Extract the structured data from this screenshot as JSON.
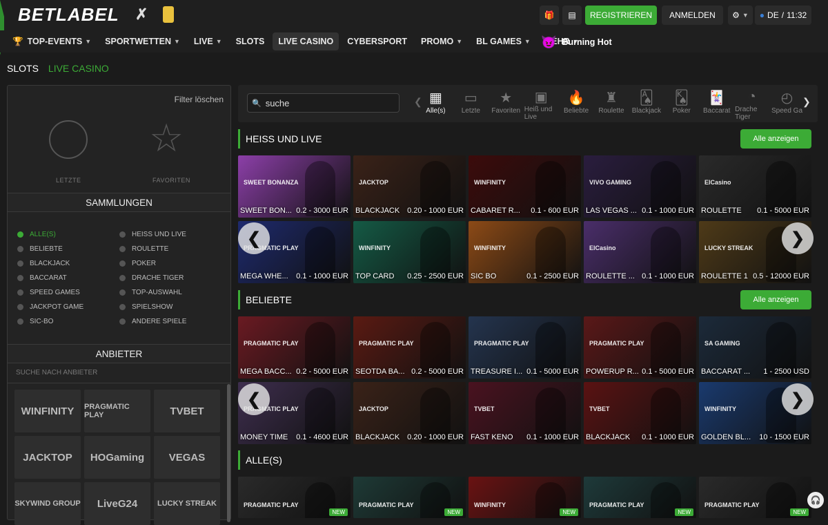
{
  "header": {
    "logo": "BETLABEL",
    "register": "REGISTRIEREN",
    "login": "ANMELDEN",
    "lang": "DE",
    "time": "11:32",
    "gift_count": "1"
  },
  "nav": {
    "items": [
      {
        "label": "TOP-EVENTS",
        "dropdown": true
      },
      {
        "label": "SPORTWETTEN",
        "dropdown": true
      },
      {
        "label": "LIVE",
        "dropdown": true
      },
      {
        "label": "SLOTS",
        "dropdown": false
      },
      {
        "label": "LIVE CASINO",
        "dropdown": false
      },
      {
        "label": "CYBERSPORT",
        "dropdown": false
      },
      {
        "label": "PROMO",
        "dropdown": true
      },
      {
        "label": "BL GAMES",
        "dropdown": true
      },
      {
        "label": "MEHR",
        "dropdown": true
      }
    ],
    "active": "LIVE CASINO",
    "promo": "Burning Hot"
  },
  "subtabs": {
    "slots": "SLOTS",
    "live_casino": "LIVE CASINO"
  },
  "sidebar": {
    "filter_clear": "Filter löschen",
    "recent": "LETZTE",
    "favorites": "FAVORITEN",
    "collections_title": "SAMMLUNGEN",
    "collections": [
      "ALLE(S)",
      "HEISS UND LIVE",
      "BELIEBTE",
      "ROULETTE",
      "BLACKJACK",
      "POKER",
      "BACCARAT",
      "DRACHE TIGER",
      "SPEED GAMES",
      "TOP-AUSWAHL",
      "JACKPOT GAME",
      "SPIELSHOW",
      "SIC-BO",
      "ANDERE SPIELE"
    ],
    "providers_title": "ANBIETER",
    "providers_search": "SUCHE NACH ANBIETER",
    "providers": [
      "WINFINITY",
      "PRAGMATIC PLAY",
      "TVBET",
      "JACKTOP",
      "HOGaming",
      "VEGAS",
      "SKYWIND GROUP",
      "LiveG24",
      "LUCKY STREAK"
    ]
  },
  "toolbar": {
    "search_placeholder": "suche",
    "categories": [
      "Alle(s)",
      "Letzte",
      "Favoriten",
      "Heiß und Live",
      "Beliebte",
      "Roulette",
      "Blackjack",
      "Poker",
      "Baccarat",
      "Drache Tiger",
      "Speed Ga"
    ]
  },
  "sections": [
    {
      "title": "HEISS UND LIVE",
      "show_all": "Alle anzeigen",
      "games": [
        {
          "name": "SWEET BON...",
          "limit": "0.2 - 3000 EUR",
          "brand": "SWEET BONANZA",
          "color": "#8c3fa8"
        },
        {
          "name": "BLACKJACK",
          "limit": "0.20 - 1000 EUR",
          "brand": "JACKTOP",
          "color": "#3a2218"
        },
        {
          "name": "CABARET R...",
          "limit": "0.1 - 600 EUR",
          "brand": "WINFINITY",
          "color": "#3c0b0b"
        },
        {
          "name": "LAS VEGAS ...",
          "limit": "0.1 - 1000 EUR",
          "brand": "VIVO GAMING",
          "color": "#2a1d3e"
        },
        {
          "name": "ROULETTE",
          "limit": "0.1 - 5000 EUR",
          "brand": "ElCasino",
          "color": "#2a2a2a"
        },
        {
          "name": "MEGA WHE...",
          "limit": "0.1 - 1000 EUR",
          "brand": "PRAGMATIC PLAY",
          "color": "#1e2a6e"
        },
        {
          "name": "TOP CARD",
          "limit": "0.25 - 2500 EUR",
          "brand": "WINFINITY",
          "color": "#145a45"
        },
        {
          "name": "SIC BO",
          "limit": "0.1 - 2500 EUR",
          "brand": "WINFINITY",
          "color": "#8c4a16"
        },
        {
          "name": "ROULETTE ...",
          "limit": "0.1 - 1000 EUR",
          "brand": "ElCasino",
          "color": "#4a2e6a"
        },
        {
          "name": "ROULETTE 1",
          "limit": "0.5 - 12000 EUR",
          "brand": "LUCKY STREAK",
          "color": "#4e3a18"
        }
      ]
    },
    {
      "title": "BELIEBTE",
      "show_all": "Alle anzeigen",
      "games": [
        {
          "name": "MEGA BACC...",
          "limit": "0.2 - 5000 EUR",
          "brand": "PRAGMATIC PLAY",
          "color": "#6a1a22"
        },
        {
          "name": "SEOTDA BA...",
          "limit": "0.2 - 5000 EUR",
          "brand": "PRAGMATIC PLAY",
          "color": "#5a1a12"
        },
        {
          "name": "TREASURE I...",
          "limit": "0.1 - 5000 EUR",
          "brand": "PRAGMATIC PLAY",
          "color": "#24344e"
        },
        {
          "name": "POWERUP R...",
          "limit": "0.1 - 5000 EUR",
          "brand": "PRAGMATIC PLAY",
          "color": "#5a1818"
        },
        {
          "name": "BACCARAT ...",
          "limit": "1 - 2500 USD",
          "brand": "SA GAMING",
          "color": "#1c2a3a"
        },
        {
          "name": "MONEY TIME",
          "limit": "0.1 - 4600 EUR",
          "brand": "PRAGMATIC PLAY",
          "color": "#3e2e4e"
        },
        {
          "name": "BLACKJACK",
          "limit": "0.20 - 1000 EUR",
          "brand": "JACKTOP",
          "color": "#3a2218"
        },
        {
          "name": "FAST KENO",
          "limit": "0.1 - 1000 EUR",
          "brand": "TVBET",
          "color": "#4a1220"
        },
        {
          "name": "BLACKJACK",
          "limit": "0.1 - 1000 EUR",
          "brand": "TVBET",
          "color": "#5a1212"
        },
        {
          "name": "GOLDEN BL...",
          "limit": "10 - 1500 EUR",
          "brand": "WINFINITY",
          "color": "#1a3a6e"
        }
      ]
    },
    {
      "title": "ALLE(S)",
      "games": [
        {
          "brand": "PRAGMATIC PLAY",
          "badge": "NEW",
          "color": "#2a2a2a"
        },
        {
          "brand": "PRAGMATIC PLAY",
          "badge": "NEW",
          "color": "#1e3a36"
        },
        {
          "brand": "WINFINITY",
          "badge": "NEW",
          "color": "#6a1212"
        },
        {
          "brand": "PRAGMATIC PLAY",
          "badge": "NEW",
          "color": "#1e3a3a"
        },
        {
          "brand": "PRAGMATIC PLAY",
          "badge": "NEW",
          "color": "#2a2a2a"
        }
      ]
    }
  ],
  "colors": {
    "accent": "#3cab36",
    "bg": "#1b1b1b",
    "panel": "#232323"
  },
  "icons": {
    "prev": "chevron-left-icon",
    "next": "chevron-right-icon",
    "support": "headset-icon"
  }
}
